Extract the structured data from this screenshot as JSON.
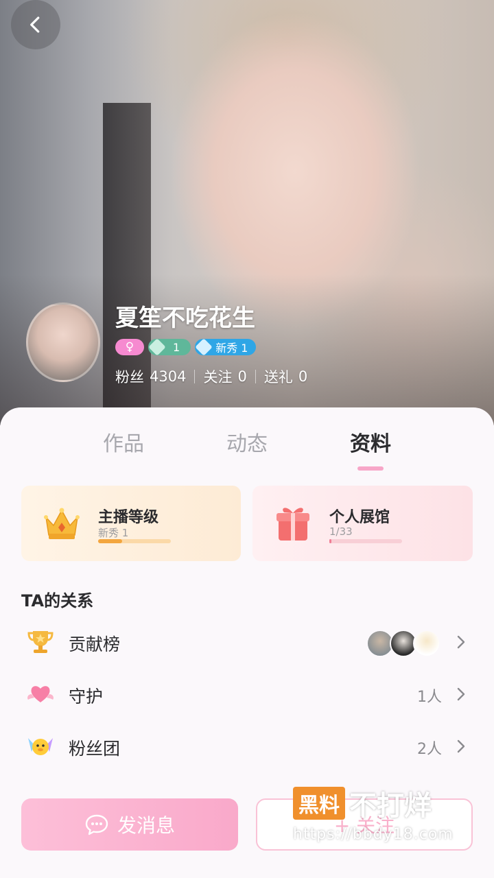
{
  "profile": {
    "name": "夏笙不吃花生",
    "gender_symbol": "♀",
    "level_badge": "1",
    "rookie_badge": "新秀 1",
    "stats": {
      "fans_label": "粉丝",
      "fans_value": "4304",
      "following_label": "关注",
      "following_value": "0",
      "gifts_label": "送礼",
      "gifts_value": "0"
    }
  },
  "tabs": [
    {
      "label": "作品",
      "active": false
    },
    {
      "label": "动态",
      "active": false
    },
    {
      "label": "资料",
      "active": true
    }
  ],
  "cards": {
    "anchor_level": {
      "title": "主播等级",
      "subtitle": "新秀 1",
      "progress": 0.33
    },
    "gallery": {
      "title": "个人展馆",
      "subtitle": "1/33",
      "progress": 0.03
    }
  },
  "relations": {
    "title": "TA的关系",
    "items": [
      {
        "label": "贡献榜",
        "count": ""
      },
      {
        "label": "守护",
        "count": "1人"
      },
      {
        "label": "粉丝团",
        "count": "2人"
      }
    ]
  },
  "actions": {
    "message_label": "发消息",
    "follow_label": "+ 关注"
  },
  "watermark": {
    "box": "黑料",
    "text": "不打烊",
    "url": "https://bbdy18.com"
  },
  "colors": {
    "accent_pink": "#f9a9ca",
    "tab_underline": "#f7a6c8",
    "level_bar": "#f3a63f",
    "gallery_bar": "#f07e95"
  }
}
